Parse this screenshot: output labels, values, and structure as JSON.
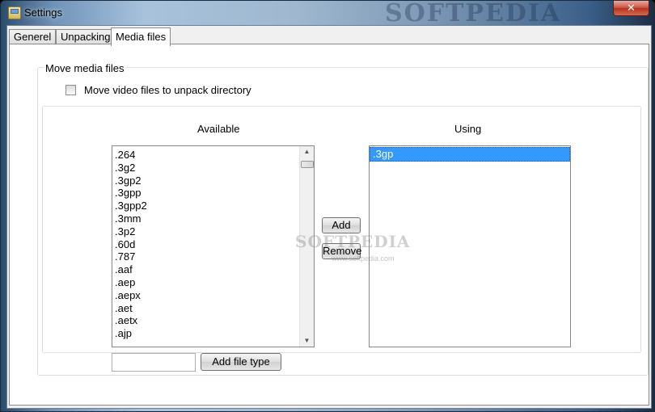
{
  "window": {
    "title": "Settings",
    "close_symbol": "✕",
    "watermark": "SOFTPEDIA",
    "icon": "settings-app-icon"
  },
  "tabs": [
    {
      "label": "Generel",
      "active": false
    },
    {
      "label": "Unpacking",
      "active": false
    },
    {
      "label": "Media files",
      "active": true
    }
  ],
  "media": {
    "group_title": "Move media files",
    "move_checkbox": {
      "label": "Move video files to unpack directory",
      "checked": false
    },
    "available_header": "Available",
    "using_header": "Using",
    "available_items": [
      ".264",
      ".3g2",
      ".3gp2",
      ".3gpp",
      ".3gpp2",
      ".3mm",
      ".3p2",
      ".60d",
      ".787",
      ".aaf",
      ".aep",
      ".aepx",
      ".aet",
      ".aetx",
      ".ajp"
    ],
    "using_items": [
      ".3gp"
    ],
    "add_label": "Add",
    "remove_label": "Remove",
    "file_type_input": {
      "value": "",
      "placeholder": ""
    },
    "add_file_type_label": "Add file type",
    "scroll_up_symbol": "▲",
    "scroll_down_symbol": "▼"
  },
  "watermark_center": "SOFTPEDIA",
  "watermark_center_sub": "www.softpedia.com",
  "colors": {
    "selection": "#3399ff",
    "panel": "#ffffff",
    "chrome": "#f0f0f0"
  }
}
